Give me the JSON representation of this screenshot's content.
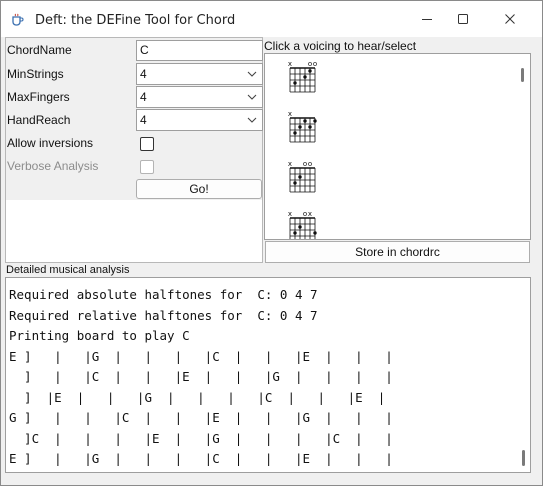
{
  "window": {
    "title": "Deft: the DEFine Tool for Chord"
  },
  "form": {
    "chord_name_label": "ChordName",
    "chord_name_value": "C",
    "min_strings_label": "MinStrings",
    "min_strings_value": "4",
    "max_fingers_label": "MaxFingers",
    "max_fingers_value": "4",
    "hand_reach_label": "HandReach",
    "hand_reach_value": "4",
    "allow_inversions_label": "Allow inversions",
    "allow_inversions_checked": false,
    "verbose_label": "Verbose Analysis",
    "verbose_checked": false,
    "go_label": "Go!"
  },
  "voicings": {
    "label": "Click a voicing to hear/select",
    "items": [
      {
        "markers": [
          "x",
          "",
          "",
          "",
          "o",
          "o"
        ],
        "dots": [
          [
            1,
            3
          ],
          [
            3,
            2
          ],
          [
            4,
            1
          ]
        ]
      },
      {
        "markers": [
          "x",
          "",
          "",
          "",
          "",
          ""
        ],
        "dots": [
          [
            1,
            3
          ],
          [
            2,
            2
          ],
          [
            3,
            1
          ],
          [
            4,
            2
          ],
          [
            5,
            1
          ]
        ]
      },
      {
        "markers": [
          "x",
          "",
          "",
          "o",
          "o",
          ""
        ],
        "dots": [
          [
            1,
            3
          ],
          [
            2,
            2
          ]
        ]
      },
      {
        "markers": [
          "x",
          "",
          "",
          "o",
          "x",
          ""
        ],
        "dots": [
          [
            1,
            3
          ],
          [
            2,
            2
          ],
          [
            5,
            3
          ]
        ]
      }
    ],
    "store_label": "Store in chordrc"
  },
  "analysis": {
    "label": "Detailed musical analysis",
    "lines": [
      "Required absolute halftones for  C: 0 4 7",
      "Required relative halftones for  C: 0 4 7",
      "Printing board to play C",
      "E ]   |   |G  |   |   |   |C  |   |   |E  |   |   |",
      "  ]   |   |C  |   |   |E  |   |   |G  |   |   |   |",
      "  ]  |E  |   |   |G  |   |   |   |C  |   |   |E  |",
      "G ]   |   |   |C  |   |   |E  |   |   |G  |   |   |",
      "  ]C  |   |   |   |E  |   |G  |   |   |   |C  |   |",
      "E ]   |   |G  |   |   |   |C  |   |   |E  |   |   |"
    ]
  },
  "icons": {
    "app": "coffee-cup-icon",
    "minimize": "minimize-icon",
    "maximize": "maximize-icon",
    "close": "close-icon",
    "dropdown": "chevron-down-icon"
  }
}
